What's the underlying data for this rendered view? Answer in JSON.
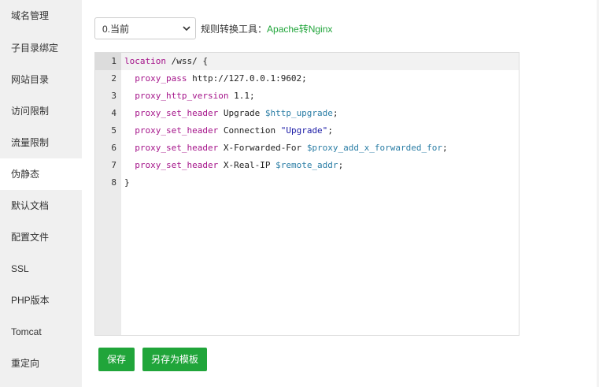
{
  "sidebar": {
    "items": [
      {
        "label": "域名管理"
      },
      {
        "label": "子目录绑定"
      },
      {
        "label": "网站目录"
      },
      {
        "label": "访问限制"
      },
      {
        "label": "流量限制"
      },
      {
        "label": "伪静态"
      },
      {
        "label": "默认文档"
      },
      {
        "label": "配置文件"
      },
      {
        "label": "SSL"
      },
      {
        "label": "PHP版本"
      },
      {
        "label": "Tomcat"
      },
      {
        "label": "重定向"
      }
    ],
    "active_index": 5
  },
  "toolbar": {
    "select_value": "0.当前",
    "rule_label": "规则转换工具：",
    "rule_link": "Apache转Nginx"
  },
  "editor": {
    "lines": [
      {
        "num": "1",
        "parts": [
          {
            "t": "location",
            "c": "kw"
          },
          {
            "t": " /wss/ {",
            "c": "txt"
          }
        ]
      },
      {
        "num": "2",
        "parts": [
          {
            "t": "  proxy_pass",
            "c": "kw"
          },
          {
            "t": " http://127.0.0.1:9602;",
            "c": "txt"
          }
        ]
      },
      {
        "num": "3",
        "parts": [
          {
            "t": "  proxy_http_version",
            "c": "kw"
          },
          {
            "t": " 1.1;",
            "c": "txt"
          }
        ]
      },
      {
        "num": "4",
        "parts": [
          {
            "t": "  proxy_set_header",
            "c": "kw"
          },
          {
            "t": " Upgrade ",
            "c": "txt"
          },
          {
            "t": "$http_upgrade",
            "c": "var"
          },
          {
            "t": ";",
            "c": "txt"
          }
        ]
      },
      {
        "num": "5",
        "parts": [
          {
            "t": "  proxy_set_header",
            "c": "kw"
          },
          {
            "t": " Connection ",
            "c": "txt"
          },
          {
            "t": "\"Upgrade\"",
            "c": "str"
          },
          {
            "t": ";",
            "c": "txt"
          }
        ]
      },
      {
        "num": "6",
        "parts": [
          {
            "t": "  proxy_set_header",
            "c": "kw"
          },
          {
            "t": " X-Forwarded-For ",
            "c": "txt"
          },
          {
            "t": "$proxy_add_x_forwarded_for",
            "c": "var"
          },
          {
            "t": ";",
            "c": "txt"
          }
        ]
      },
      {
        "num": "7",
        "parts": [
          {
            "t": "  proxy_set_header",
            "c": "kw"
          },
          {
            "t": " X-Real-IP ",
            "c": "txt"
          },
          {
            "t": "$remote_addr",
            "c": "var"
          },
          {
            "t": ";",
            "c": "txt"
          }
        ]
      },
      {
        "num": "8",
        "parts": [
          {
            "t": "}",
            "c": "txt"
          }
        ]
      }
    ]
  },
  "buttons": {
    "save": "保存",
    "save_as_template": "另存为模板"
  },
  "colors": {
    "accent": "#20a53a",
    "keyword": "#a5148a",
    "variable": "#2a7da5",
    "string": "#1a1aa6"
  }
}
